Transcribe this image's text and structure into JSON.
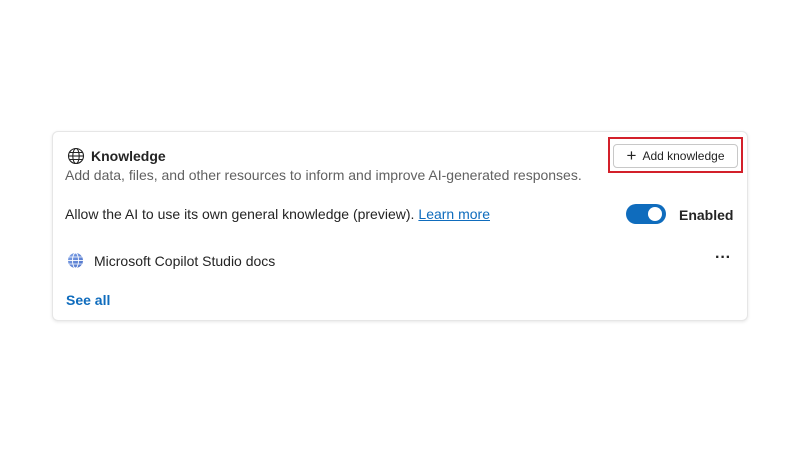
{
  "knowledge": {
    "title": "Knowledge",
    "description": "Add data, files, and other resources to inform and improve AI-generated responses.",
    "add_button_label": "Add knowledge",
    "allow_text": "Allow the AI to use its own general knowledge (preview).",
    "learn_more_label": "Learn more",
    "toggle_state": "on",
    "enabled_label": "Enabled",
    "sources": [
      {
        "label": "Microsoft Copilot Studio docs",
        "icon": "web-globe-icon"
      }
    ],
    "more_label": "···",
    "see_all_label": "See all"
  },
  "colors": {
    "accent": "#0f6cbd",
    "highlight": "#d3202a",
    "text": "#242424",
    "muted": "#616161"
  },
  "icons": {
    "header": "globe-icon",
    "add": "plus-icon",
    "source": "web-globe-icon",
    "more": "more-icon"
  }
}
